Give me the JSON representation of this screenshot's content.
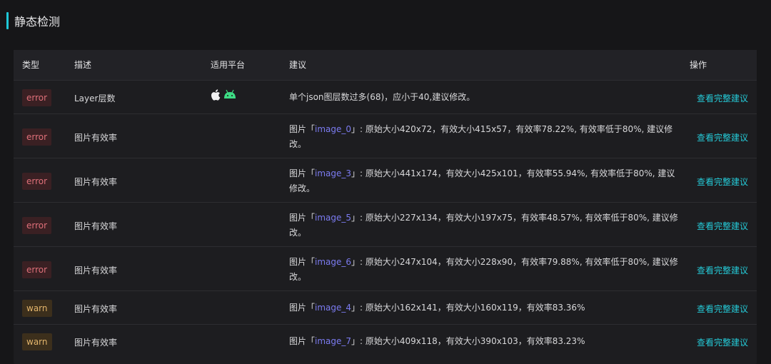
{
  "section": {
    "title": "静态检测"
  },
  "table": {
    "columns": [
      "类型",
      "描述",
      "适用平台",
      "建议",
      "操作"
    ],
    "rows": [
      {
        "type": "error",
        "desc": "Layer层数",
        "platform_icons": [
          "apple-icon",
          "android-icon"
        ],
        "suggest_plain": "单个json图层数过多(68)，应小于40,建议修改。",
        "action": "查看完整建议"
      },
      {
        "type": "error",
        "desc": "图片有效率",
        "suggest_prefix": "图片「",
        "suggest_highlight": "image_0",
        "suggest_suffix": "」: 原始大小420x72，有效大小415x57，有效率78.22%, 有效率低于80%, 建议修改。",
        "action": "查看完整建议"
      },
      {
        "type": "error",
        "desc": "图片有效率",
        "suggest_prefix": "图片「",
        "suggest_highlight": "image_3",
        "suggest_suffix": "」: 原始大小441x174，有效大小425x101，有效率55.94%, 有效率低于80%, 建议修改。",
        "action": "查看完整建议"
      },
      {
        "type": "error",
        "desc": "图片有效率",
        "suggest_prefix": "图片「",
        "suggest_highlight": "image_5",
        "suggest_suffix": "」: 原始大小227x134，有效大小197x75，有效率48.57%, 有效率低于80%, 建议修改。",
        "action": "查看完整建议"
      },
      {
        "type": "error",
        "desc": "图片有效率",
        "suggest_prefix": "图片「",
        "suggest_highlight": "image_6",
        "suggest_suffix": "」: 原始大小247x104，有效大小228x90，有效率79.88%, 有效率低于80%, 建议修改。",
        "action": "查看完整建议"
      },
      {
        "type": "warn",
        "desc": "图片有效率",
        "suggest_prefix": "图片「",
        "suggest_highlight": "image_4",
        "suggest_suffix": "」: 原始大小162x141，有效大小160x119，有效率83.36%",
        "action": "查看完整建议"
      },
      {
        "type": "warn",
        "desc": "图片有效率",
        "suggest_prefix": "图片「",
        "suggest_highlight": "image_7",
        "suggest_suffix": "」: 原始大小409x118，有效大小390x103，有效率83.23%",
        "action": "查看完整建议"
      }
    ]
  },
  "colors": {
    "accent": "#1ec8d8",
    "error": "#e0707a",
    "warn": "#e3b56c",
    "link": "#25c9d6",
    "highlight": "#7b7bf0"
  }
}
